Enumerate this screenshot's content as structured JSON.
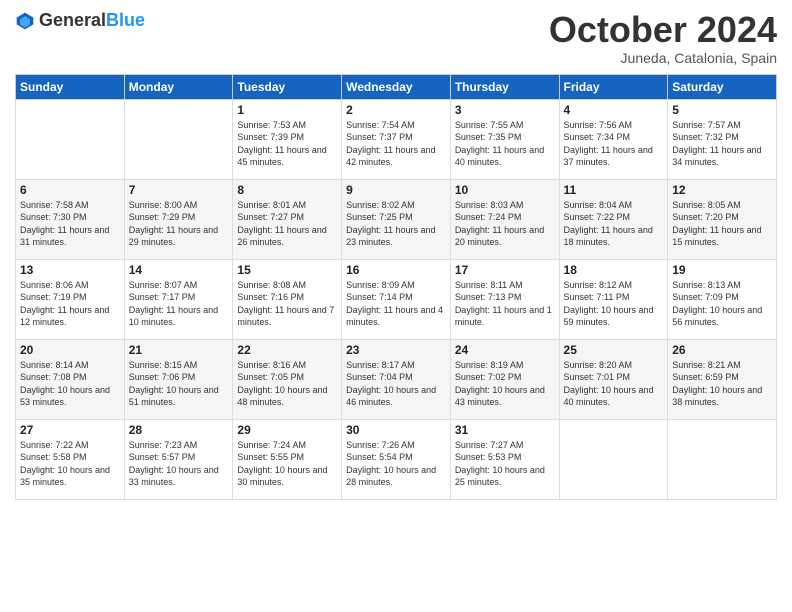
{
  "header": {
    "logo_general": "General",
    "logo_blue": "Blue",
    "month_title": "October 2024",
    "location": "Juneda, Catalonia, Spain"
  },
  "days_of_week": [
    "Sunday",
    "Monday",
    "Tuesday",
    "Wednesday",
    "Thursday",
    "Friday",
    "Saturday"
  ],
  "weeks": [
    [
      {
        "day": "",
        "info": ""
      },
      {
        "day": "",
        "info": ""
      },
      {
        "day": "1",
        "info": "Sunrise: 7:53 AM\nSunset: 7:39 PM\nDaylight: 11 hours and 45 minutes."
      },
      {
        "day": "2",
        "info": "Sunrise: 7:54 AM\nSunset: 7:37 PM\nDaylight: 11 hours and 42 minutes."
      },
      {
        "day": "3",
        "info": "Sunrise: 7:55 AM\nSunset: 7:35 PM\nDaylight: 11 hours and 40 minutes."
      },
      {
        "day": "4",
        "info": "Sunrise: 7:56 AM\nSunset: 7:34 PM\nDaylight: 11 hours and 37 minutes."
      },
      {
        "day": "5",
        "info": "Sunrise: 7:57 AM\nSunset: 7:32 PM\nDaylight: 11 hours and 34 minutes."
      }
    ],
    [
      {
        "day": "6",
        "info": "Sunrise: 7:58 AM\nSunset: 7:30 PM\nDaylight: 11 hours and 31 minutes."
      },
      {
        "day": "7",
        "info": "Sunrise: 8:00 AM\nSunset: 7:29 PM\nDaylight: 11 hours and 29 minutes."
      },
      {
        "day": "8",
        "info": "Sunrise: 8:01 AM\nSunset: 7:27 PM\nDaylight: 11 hours and 26 minutes."
      },
      {
        "day": "9",
        "info": "Sunrise: 8:02 AM\nSunset: 7:25 PM\nDaylight: 11 hours and 23 minutes."
      },
      {
        "day": "10",
        "info": "Sunrise: 8:03 AM\nSunset: 7:24 PM\nDaylight: 11 hours and 20 minutes."
      },
      {
        "day": "11",
        "info": "Sunrise: 8:04 AM\nSunset: 7:22 PM\nDaylight: 11 hours and 18 minutes."
      },
      {
        "day": "12",
        "info": "Sunrise: 8:05 AM\nSunset: 7:20 PM\nDaylight: 11 hours and 15 minutes."
      }
    ],
    [
      {
        "day": "13",
        "info": "Sunrise: 8:06 AM\nSunset: 7:19 PM\nDaylight: 11 hours and 12 minutes."
      },
      {
        "day": "14",
        "info": "Sunrise: 8:07 AM\nSunset: 7:17 PM\nDaylight: 11 hours and 10 minutes."
      },
      {
        "day": "15",
        "info": "Sunrise: 8:08 AM\nSunset: 7:16 PM\nDaylight: 11 hours and 7 minutes."
      },
      {
        "day": "16",
        "info": "Sunrise: 8:09 AM\nSunset: 7:14 PM\nDaylight: 11 hours and 4 minutes."
      },
      {
        "day": "17",
        "info": "Sunrise: 8:11 AM\nSunset: 7:13 PM\nDaylight: 11 hours and 1 minute."
      },
      {
        "day": "18",
        "info": "Sunrise: 8:12 AM\nSunset: 7:11 PM\nDaylight: 10 hours and 59 minutes."
      },
      {
        "day": "19",
        "info": "Sunrise: 8:13 AM\nSunset: 7:09 PM\nDaylight: 10 hours and 56 minutes."
      }
    ],
    [
      {
        "day": "20",
        "info": "Sunrise: 8:14 AM\nSunset: 7:08 PM\nDaylight: 10 hours and 53 minutes."
      },
      {
        "day": "21",
        "info": "Sunrise: 8:15 AM\nSunset: 7:06 PM\nDaylight: 10 hours and 51 minutes."
      },
      {
        "day": "22",
        "info": "Sunrise: 8:16 AM\nSunset: 7:05 PM\nDaylight: 10 hours and 48 minutes."
      },
      {
        "day": "23",
        "info": "Sunrise: 8:17 AM\nSunset: 7:04 PM\nDaylight: 10 hours and 46 minutes."
      },
      {
        "day": "24",
        "info": "Sunrise: 8:19 AM\nSunset: 7:02 PM\nDaylight: 10 hours and 43 minutes."
      },
      {
        "day": "25",
        "info": "Sunrise: 8:20 AM\nSunset: 7:01 PM\nDaylight: 10 hours and 40 minutes."
      },
      {
        "day": "26",
        "info": "Sunrise: 8:21 AM\nSunset: 6:59 PM\nDaylight: 10 hours and 38 minutes."
      }
    ],
    [
      {
        "day": "27",
        "info": "Sunrise: 7:22 AM\nSunset: 5:58 PM\nDaylight: 10 hours and 35 minutes."
      },
      {
        "day": "28",
        "info": "Sunrise: 7:23 AM\nSunset: 5:57 PM\nDaylight: 10 hours and 33 minutes."
      },
      {
        "day": "29",
        "info": "Sunrise: 7:24 AM\nSunset: 5:55 PM\nDaylight: 10 hours and 30 minutes."
      },
      {
        "day": "30",
        "info": "Sunrise: 7:26 AM\nSunset: 5:54 PM\nDaylight: 10 hours and 28 minutes."
      },
      {
        "day": "31",
        "info": "Sunrise: 7:27 AM\nSunset: 5:53 PM\nDaylight: 10 hours and 25 minutes."
      },
      {
        "day": "",
        "info": ""
      },
      {
        "day": "",
        "info": ""
      }
    ]
  ]
}
